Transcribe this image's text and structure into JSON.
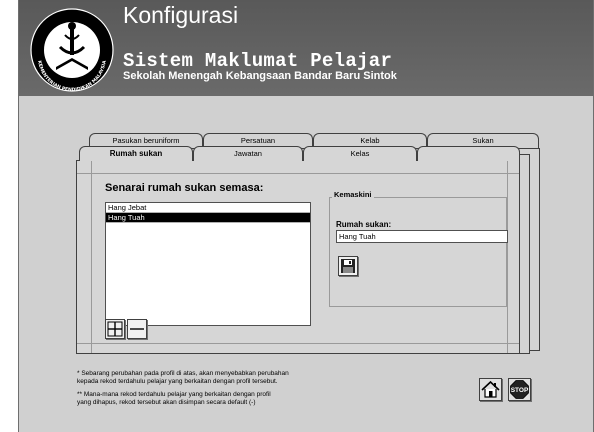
{
  "header": {
    "title": "Konfigurasi",
    "subtitle": "Sistem Maklumat Pelajar",
    "school": "Sekolah Menengah Kebangsaan Bandar Baru Sintok",
    "logo_text": "KEMENTERIAN PENDIDIKAN MALAYSIA"
  },
  "tabs": {
    "back_row": [
      "Pasukan beruniform",
      "Persatuan",
      "Kelab",
      "Sukan"
    ],
    "front_row": [
      "Rumah sukan",
      "Jawatan",
      "Kelas",
      ""
    ],
    "active": "Rumah sukan"
  },
  "list": {
    "title": "Senarai rumah sukan semasa:",
    "items": [
      "Hang Jebat",
      "Hang Tuah"
    ],
    "selected": "Hang Tuah"
  },
  "edit": {
    "group_label": "Kemaskini",
    "field_label": "Rumah sukan:",
    "field_value": "Hang Tuah"
  },
  "buttons": {
    "add": "add-icon",
    "remove": "remove-icon",
    "save": "floppy-disk-icon",
    "home": "home-icon",
    "stop": "STOP"
  },
  "notes": [
    "*   Sebarang perubahan pada profil di atas, akan menyebabkan perubahan",
    "kepada rekod terdahulu pelajar yang berkaitan dengan profil tersebut.",
    "**   Mana-mana rekod terdahulu pelajar yang berkaitan dengan profil",
    "yang dihapus, rekod tersebut  akan disimpan secara default (-)"
  ],
  "colors": {
    "header_bg": "#5f5f5f",
    "panel_bg": "#d0d0d0",
    "stop_red": "#b00000"
  }
}
